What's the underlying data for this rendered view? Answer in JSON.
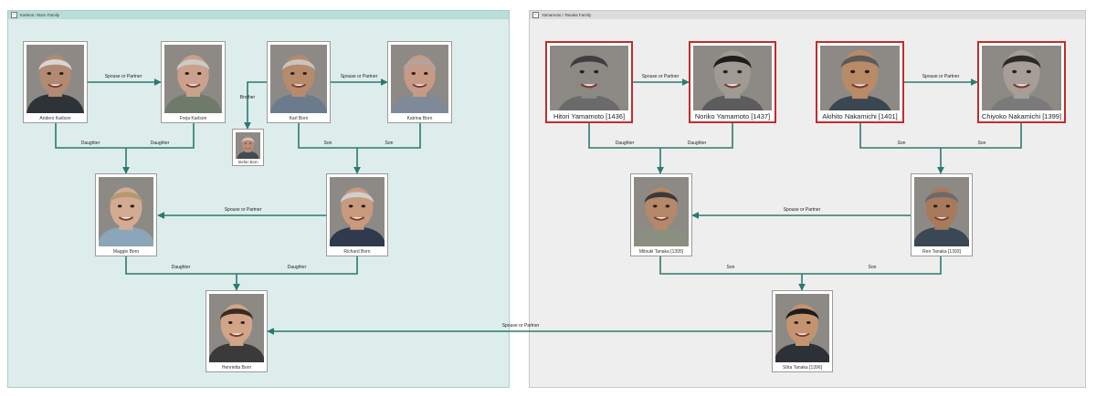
{
  "groups": {
    "left": {
      "title": "Karlson / Born Family",
      "collapse_icon": "minus-icon"
    },
    "right": {
      "title": "Yamamoto / Tanaka Family",
      "collapse_icon": "minus-icon"
    }
  },
  "people": {
    "anders": {
      "name": "Anders Karlson"
    },
    "freja": {
      "name": "Freja Karlson"
    },
    "karl": {
      "name": "Karl Born"
    },
    "katrina": {
      "name": "Katrina Born"
    },
    "stefan": {
      "name": "Stefan Born"
    },
    "maggie": {
      "name": "Maggie Born"
    },
    "richard": {
      "name": "Richard Born"
    },
    "henrietta": {
      "name": "Henrietta Born"
    },
    "hitori": {
      "name": "Hitori Yamamoto [1436]"
    },
    "noriko": {
      "name": "Noriko Yamamoto [1437]"
    },
    "akihito": {
      "name": "Akihito Nakamichi [1401]"
    },
    "chiyoko": {
      "name": "Chiyoko Nakamichi [1399]"
    },
    "mitsuki": {
      "name": "Mitsuki Tanaka [1395]"
    },
    "ren": {
      "name": "Ren Tanaka [1393]"
    },
    "sota": {
      "name": "Sōta Tanaka [1396]"
    }
  },
  "relations": {
    "spouse": "Spouse or Partner",
    "brother": "Brother",
    "daughter": "Daughter",
    "son": "Son"
  },
  "colors": {
    "edge": "#2b7a6f",
    "highlight_border": "#c52a2a"
  }
}
